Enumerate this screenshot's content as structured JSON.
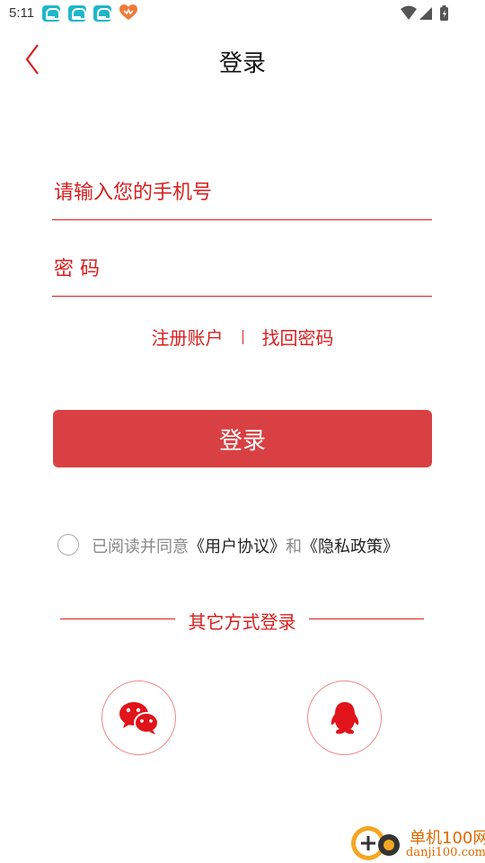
{
  "status_bar": {
    "time": "5:11",
    "notification_icons": [
      "app-notification-icon",
      "app-notification-icon",
      "app-notification-icon",
      "heart-icon"
    ],
    "right_icons": [
      "wifi-icon",
      "signal-icon",
      "battery-icon"
    ]
  },
  "header": {
    "title": "登录",
    "back_icon": "chevron-left-icon"
  },
  "form": {
    "phone_placeholder": "请输入您的手机号",
    "password_placeholder": "密 码",
    "register_link": "注册账户",
    "forgot_link": "找回密码",
    "login_button": "登录"
  },
  "agreement": {
    "checked": false,
    "prefix": "已阅读并同意",
    "user_agreement": "《用户协议》",
    "connector": "和",
    "privacy_policy": "《隐私政策》"
  },
  "other_login": {
    "label": "其它方式登录",
    "methods": [
      "wechat-icon",
      "qq-icon"
    ]
  },
  "watermark": {
    "title": "单机100网",
    "url": "danji100.com"
  },
  "colors": {
    "accent": "#d71f1f",
    "button": "#d94043",
    "watermark": "#e06a00"
  }
}
